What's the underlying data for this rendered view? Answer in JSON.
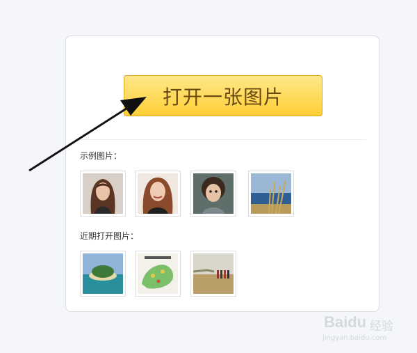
{
  "open_button_label": "打开一张图片",
  "sections": {
    "sample_label": "示例图片：",
    "recent_label": "近期打开图片："
  },
  "sample_images": [
    {
      "subject": "woman with long brown hair portrait"
    },
    {
      "subject": "smiling woman portrait"
    },
    {
      "subject": "curly haired child portrait"
    },
    {
      "subject": "grass by the sea"
    }
  ],
  "recent_images": [
    {
      "subject": "tropical island"
    },
    {
      "subject": "map"
    },
    {
      "subject": "people walking on a path"
    }
  ],
  "watermark": {
    "brand": "Baidu",
    "product": "经验",
    "url": "jingyan.baidu.com"
  },
  "colors": {
    "button_top": "#ffe88a",
    "button_bottom": "#ffd035",
    "button_text": "#6b4a12",
    "arrow": "#111111",
    "background": "#f5f6fa"
  }
}
